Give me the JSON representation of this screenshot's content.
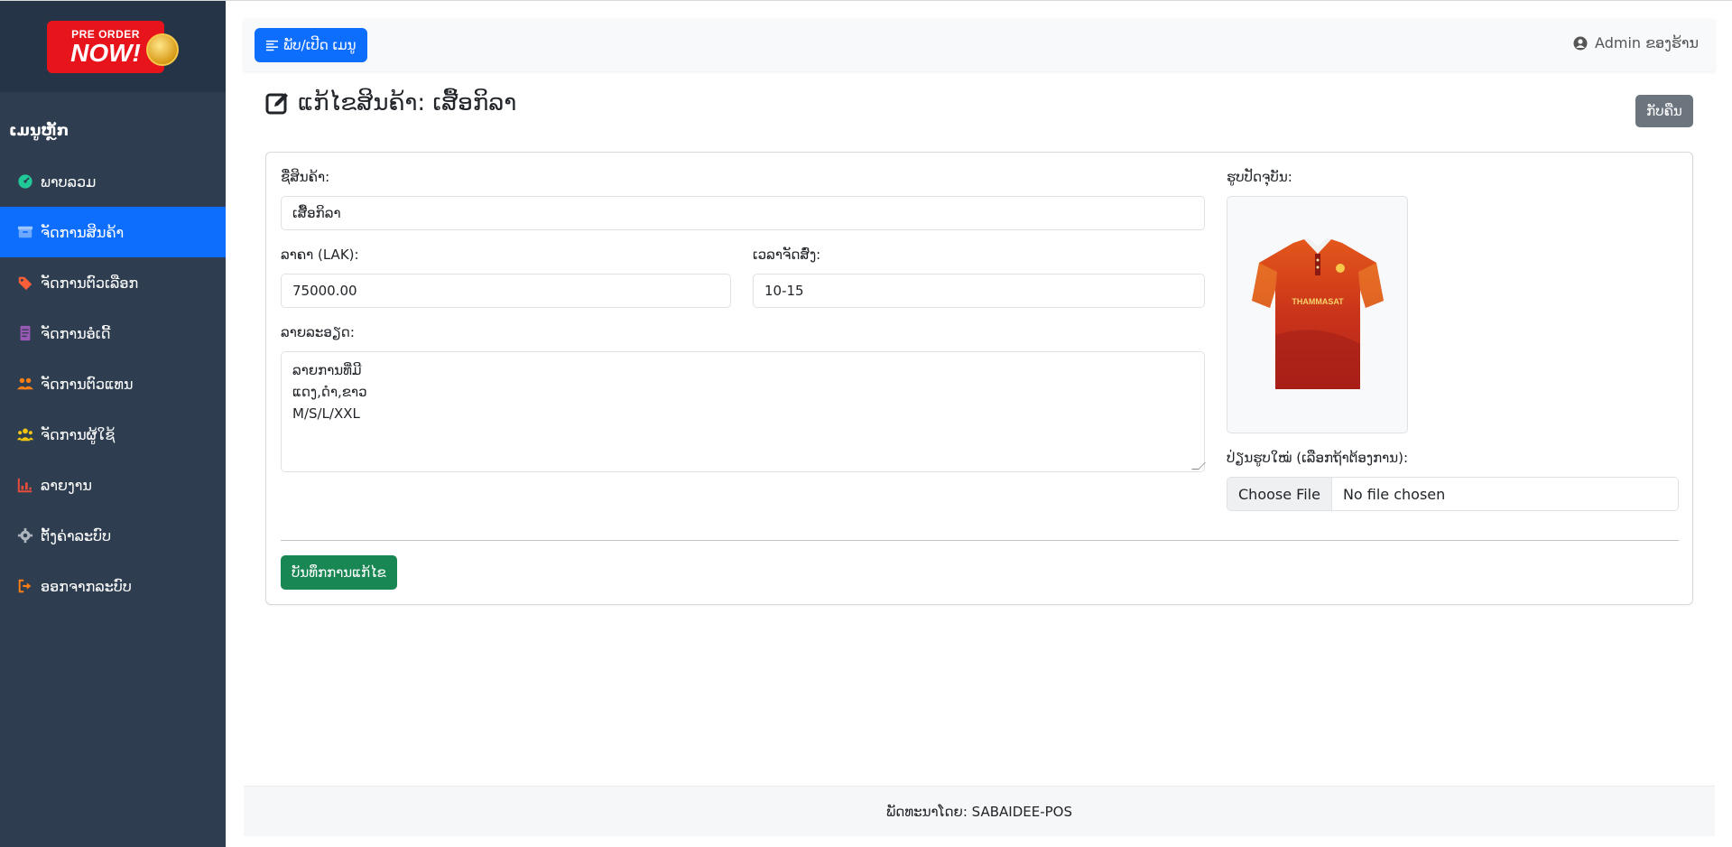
{
  "sidebar": {
    "logo": {
      "line1": "PRE ORDER",
      "line2": "NOW!"
    },
    "heading": "ເມນູຫຼັກ",
    "items": [
      {
        "label": "ພາບລວມ",
        "icon": "dashboard-icon",
        "color": "#20c997"
      },
      {
        "label": "ຈັດການສິນຄ້າ",
        "icon": "box-icon",
        "color": "#6ea8fe"
      },
      {
        "label": "ຈັດການຕົວເລືອກ",
        "icon": "tags-icon",
        "color": "#fd5e3a"
      },
      {
        "label": "ຈັດການອໍເດີ້",
        "icon": "receipt-icon",
        "color": "#9b59b6"
      },
      {
        "label": "ຈັດການຕົວແທນ",
        "icon": "users-icon",
        "color": "#fd7e14"
      },
      {
        "label": "ຈັດການຜູ້ໃຊ້",
        "icon": "user-group-icon",
        "color": "#f1c40f"
      },
      {
        "label": "ລາຍງານ",
        "icon": "chart-icon",
        "color": "#e74c3c"
      },
      {
        "label": "ຕັ້ງຄ່າລະບົບ",
        "icon": "gear-icon",
        "color": "#adb5bd"
      },
      {
        "label": "ອອກຈາກລະບົບ",
        "icon": "logout-icon",
        "color": "#fd7e14"
      }
    ],
    "active_index": 1
  },
  "topbar": {
    "toggle_label": "ພັບ/ເປີດ ເມນູ",
    "admin_label": "Admin ຂອງຮ້ານ"
  },
  "page": {
    "title": "ແກ້ໄຂສິນຄ້າ: ເສື້ອກິລາ",
    "back_label": "ກັບຄືນ"
  },
  "form": {
    "name_label": "ຊື່ສິນຄ້າ:",
    "name_value": "ເສື້ອກິລາ",
    "price_label": "ລາຄາ (LAK):",
    "price_value": "75000.00",
    "delivery_label": "ເວລາຈັດສົ່ງ:",
    "delivery_value": "10-15",
    "desc_label": "ລາຍລະອຽດ:",
    "desc_lines": [
      "ລາຍການທີ່ມີ",
      "ແດງ,ດຳ,ຂາວ",
      "M/S/L/XXL"
    ],
    "current_image_label": "ຮູບປັດຈຸບັນ:",
    "shirt_text": "THAMMASAT",
    "new_image_label": "ປ່ຽນຮູບໃໝ່ (ເລືອກຖ້າຕ້ອງການ):",
    "file_button": "Choose File",
    "file_status": "No file chosen",
    "save_label": "ບັນທຶກການແກ້ໄຂ"
  },
  "footer": {
    "text": "ພັດທະນາໂດຍ: SABAIDEE-POS"
  }
}
